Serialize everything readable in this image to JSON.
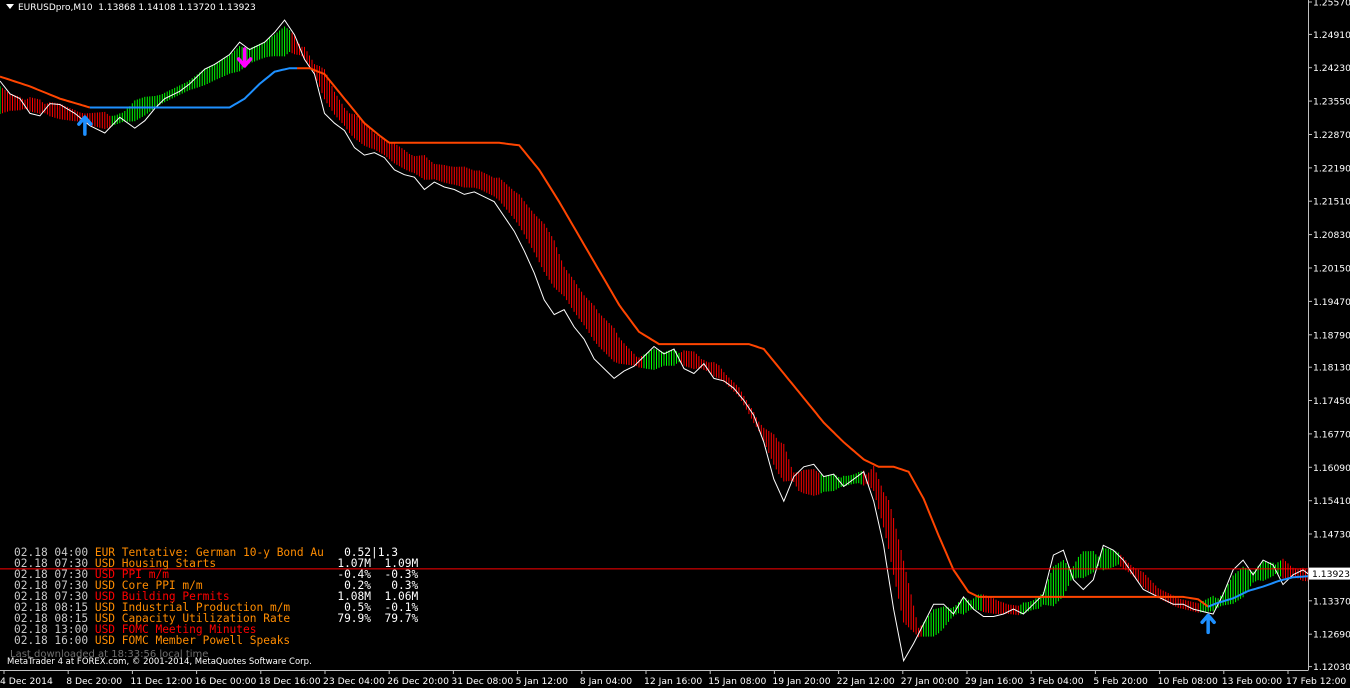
{
  "header": {
    "symbol": "EURUSDpro,M10",
    "ohlc": "1.13868 1.14108 1.13720 1.13923"
  },
  "chart_data": {
    "type": "line",
    "title": "EURUSDpro,M10",
    "x_tick_labels": [
      "4 Dec 2014",
      "8 Dec 20:00",
      "11 Dec 12:00",
      "16 Dec 00:00",
      "18 Dec 16:00",
      "23 Dec 04:00",
      "26 Dec 20:00",
      "31 Dec 08:00",
      "5 Jan 12:00",
      "8 Jan 04:00",
      "12 Jan 16:00",
      "15 Jan 08:00",
      "19 Jan 20:00",
      "22 Jan 12:00",
      "27 Jan 00:00",
      "29 Jan 16:00",
      "3 Feb 04:00",
      "5 Feb 20:00",
      "10 Feb 08:00",
      "13 Feb 00:00",
      "17 Feb 12:00"
    ],
    "y_tick_labels": [
      "1.25570",
      "1.24910",
      "1.24230",
      "1.23550",
      "1.22870",
      "1.22190",
      "1.21510",
      "1.20830",
      "1.20150",
      "1.19470",
      "1.18790",
      "1.18130",
      "1.17450",
      "1.16770",
      "1.16090",
      "1.15410",
      "1.14730",
      "1.13370",
      "1.12690",
      "1.12030"
    ],
    "ylim": [
      1.1196,
      1.2561
    ],
    "current_price": "1.13923",
    "current_price_value": 1.13923,
    "price_line_value": 1.1402,
    "colors": {
      "background": "#000000",
      "price": "#ffffff",
      "bull_histogram": "#00ff00",
      "bear_histogram": "#ff0000",
      "trail_line_down": "#ff4500",
      "trail_line_up": "#1e90ff",
      "buy_arrow": "#1e90ff",
      "sell_arrow": "#ff00ff",
      "price_line": "#ff0000"
    },
    "series": [
      {
        "role": "close",
        "points": [
          [
            0,
            1.2396
          ],
          [
            2,
            1.237
          ],
          [
            4,
            1.236
          ],
          [
            6,
            1.233
          ],
          [
            8,
            1.2325
          ],
          [
            10,
            1.235
          ],
          [
            12,
            1.2348
          ],
          [
            15,
            1.233
          ],
          [
            18,
            1.2305
          ],
          [
            21,
            1.229
          ],
          [
            24,
            1.2322
          ],
          [
            27,
            1.23
          ],
          [
            29,
            1.2315
          ],
          [
            31,
            1.234
          ],
          [
            33,
            1.236
          ],
          [
            36,
            1.2375
          ],
          [
            38,
            1.239
          ],
          [
            41,
            1.242
          ],
          [
            43,
            1.243
          ],
          [
            46,
            1.245
          ],
          [
            48,
            1.2475
          ],
          [
            50,
            1.246
          ],
          [
            53,
            1.2475
          ],
          [
            55,
            1.2495
          ],
          [
            57,
            1.252
          ],
          [
            59,
            1.249
          ],
          [
            61,
            1.244
          ],
          [
            63,
            1.241
          ],
          [
            65,
            1.233
          ],
          [
            67,
            1.231
          ],
          [
            69,
            1.2295
          ],
          [
            71,
            1.226
          ],
          [
            73,
            1.2245
          ],
          [
            75,
            1.225
          ],
          [
            77,
            1.224
          ],
          [
            79,
            1.2215
          ],
          [
            81,
            1.2205
          ],
          [
            83,
            1.22
          ],
          [
            85,
            1.2175
          ],
          [
            87,
            1.219
          ],
          [
            89,
            1.218
          ],
          [
            91,
            1.2175
          ],
          [
            93,
            1.2165
          ],
          [
            95,
            1.217
          ],
          [
            97,
            1.216
          ],
          [
            99,
            1.215
          ],
          [
            101,
            1.212
          ],
          [
            103,
            1.209
          ],
          [
            105,
            1.205
          ],
          [
            107,
            1.2005
          ],
          [
            109,
            1.195
          ],
          [
            111,
            1.192
          ],
          [
            113,
            1.193
          ],
          [
            115,
            1.1895
          ],
          [
            117,
            1.187
          ],
          [
            119,
            1.183
          ],
          [
            121,
            1.181
          ],
          [
            123,
            1.179
          ],
          [
            125,
            1.1805
          ],
          [
            127,
            1.1815
          ],
          [
            129,
            1.1835
          ],
          [
            131,
            1.1855
          ],
          [
            133,
            1.184
          ],
          [
            135,
            1.185
          ],
          [
            137,
            1.181
          ],
          [
            139,
            1.18
          ],
          [
            141,
            1.182
          ],
          [
            143,
            1.179
          ],
          [
            145,
            1.1785
          ],
          [
            147,
            1.177
          ],
          [
            149,
            1.1745
          ],
          [
            151,
            1.1715
          ],
          [
            153,
            1.166
          ],
          [
            155,
            1.1585
          ],
          [
            157,
            1.154
          ],
          [
            159,
            1.159
          ],
          [
            161,
            1.161
          ],
          [
            163,
            1.1615
          ],
          [
            165,
            1.159
          ],
          [
            167,
            1.1595
          ],
          [
            169,
            1.157
          ],
          [
            171,
            1.1585
          ],
          [
            173,
            1.16
          ],
          [
            175,
            1.154
          ],
          [
            177,
            1.145
          ],
          [
            179,
            1.132
          ],
          [
            181,
            1.1215
          ],
          [
            183,
            1.125
          ],
          [
            185,
            1.129
          ],
          [
            187,
            1.133
          ],
          [
            189,
            1.133
          ],
          [
            191,
            1.131
          ],
          [
            193,
            1.1345
          ],
          [
            195,
            1.132
          ],
          [
            197,
            1.1305
          ],
          [
            199,
            1.1305
          ],
          [
            201,
            1.131
          ],
          [
            203,
            1.132
          ],
          [
            205,
            1.131
          ],
          [
            207,
            1.133
          ],
          [
            209,
            1.135
          ],
          [
            211,
            1.143
          ],
          [
            213,
            1.144
          ],
          [
            215,
            1.138
          ],
          [
            217,
            1.136
          ],
          [
            219,
            1.138
          ],
          [
            221,
            1.145
          ],
          [
            223,
            1.144
          ],
          [
            225,
            1.142
          ],
          [
            227,
            1.139
          ],
          [
            229,
            1.136
          ],
          [
            231,
            1.135
          ],
          [
            233,
            1.134
          ],
          [
            235,
            1.133
          ],
          [
            237,
            1.133
          ],
          [
            239,
            1.132
          ],
          [
            241,
            1.1315
          ],
          [
            243,
            1.131
          ],
          [
            245,
            1.135
          ],
          [
            247,
            1.14
          ],
          [
            249,
            1.142
          ],
          [
            251,
            1.139
          ],
          [
            253,
            1.142
          ],
          [
            255,
            1.141
          ],
          [
            257,
            1.137
          ],
          [
            259,
            1.139
          ],
          [
            261,
            1.14
          ],
          [
            262,
            1.1392
          ]
        ]
      },
      {
        "role": "trail",
        "points": [
          [
            0,
            1.2405
          ],
          [
            6,
            1.2385
          ],
          [
            12,
            1.236
          ],
          [
            18,
            1.2342
          ],
          [
            23,
            1.2342
          ],
          [
            24,
            1.2342
          ],
          [
            30,
            1.2342
          ],
          [
            36,
            1.2342
          ],
          [
            42,
            1.2342
          ],
          [
            46,
            1.2342
          ],
          [
            49,
            1.236
          ],
          [
            52,
            1.239
          ],
          [
            55,
            1.2415
          ],
          [
            58,
            1.2422
          ],
          [
            62,
            1.2422
          ],
          [
            65,
            1.241
          ],
          [
            69,
            1.236
          ],
          [
            73,
            1.231
          ],
          [
            76,
            1.2285
          ],
          [
            78,
            1.227
          ],
          [
            80,
            1.227
          ],
          [
            100,
            1.227
          ],
          [
            104,
            1.2265
          ],
          [
            108,
            1.2215
          ],
          [
            112,
            1.215
          ],
          [
            116,
            1.208
          ],
          [
            120,
            1.201
          ],
          [
            124,
            1.194
          ],
          [
            128,
            1.1885
          ],
          [
            132,
            1.186
          ],
          [
            136,
            1.186
          ],
          [
            150,
            1.186
          ],
          [
            153,
            1.185
          ],
          [
            157,
            1.18
          ],
          [
            161,
            1.175
          ],
          [
            165,
            1.17
          ],
          [
            169,
            1.166
          ],
          [
            173,
            1.1625
          ],
          [
            176,
            1.161
          ],
          [
            179,
            1.161
          ],
          [
            182,
            1.16
          ],
          [
            185,
            1.1545
          ],
          [
            188,
            1.147
          ],
          [
            191,
            1.14
          ],
          [
            194,
            1.1355
          ],
          [
            196,
            1.1345
          ],
          [
            200,
            1.1345
          ],
          [
            230,
            1.1345
          ],
          [
            237,
            1.1345
          ],
          [
            240,
            1.134
          ],
          [
            242,
            1.1325
          ],
          [
            244,
            1.1333
          ],
          [
            247,
            1.1342
          ],
          [
            250,
            1.1357
          ],
          [
            253,
            1.1366
          ],
          [
            256,
            1.1377
          ],
          [
            259,
            1.1385
          ],
          [
            262,
            1.1387
          ]
        ]
      },
      {
        "role": "smooth",
        "points": [
          [
            0,
            1.235
          ],
          [
            6,
            1.2345
          ],
          [
            12,
            1.233
          ],
          [
            18,
            1.2315
          ],
          [
            22,
            1.231
          ],
          [
            26,
            1.2325
          ],
          [
            30,
            1.2345
          ],
          [
            36,
            1.2375
          ],
          [
            42,
            1.2405
          ],
          [
            48,
            1.2435
          ],
          [
            54,
            1.246
          ],
          [
            58,
            1.2472
          ],
          [
            61,
            1.245
          ],
          [
            64,
            1.24
          ],
          [
            67,
            1.2345
          ],
          [
            70,
            1.2305
          ],
          [
            74,
            1.2275
          ],
          [
            78,
            1.225
          ],
          [
            82,
            1.2225
          ],
          [
            86,
            1.221
          ],
          [
            90,
            1.22
          ],
          [
            96,
            1.219
          ],
          [
            100,
            1.217
          ],
          [
            104,
            1.2125
          ],
          [
            108,
            1.206
          ],
          [
            112,
            1.1995
          ],
          [
            116,
            1.1935
          ],
          [
            120,
            1.188
          ],
          [
            124,
            1.184
          ],
          [
            128,
            1.182
          ],
          [
            132,
            1.1825
          ],
          [
            136,
            1.183
          ],
          [
            140,
            1.182
          ],
          [
            144,
            1.18
          ],
          [
            148,
            1.176
          ],
          [
            152,
            1.169
          ],
          [
            156,
            1.162
          ],
          [
            160,
            1.1575
          ],
          [
            164,
            1.157
          ],
          [
            168,
            1.1575
          ],
          [
            172,
            1.1585
          ],
          [
            175,
            1.158
          ],
          [
            178,
            1.148
          ],
          [
            181,
            1.134
          ],
          [
            184,
            1.127
          ],
          [
            188,
            1.129
          ],
          [
            192,
            1.132
          ],
          [
            196,
            1.133
          ],
          [
            200,
            1.132
          ],
          [
            204,
            1.1315
          ],
          [
            208,
            1.133
          ],
          [
            212,
            1.1365
          ],
          [
            216,
            1.14
          ],
          [
            220,
            1.1415
          ],
          [
            224,
            1.142
          ],
          [
            228,
            1.1385
          ],
          [
            232,
            1.135
          ],
          [
            236,
            1.133
          ],
          [
            240,
            1.132
          ],
          [
            244,
            1.133
          ],
          [
            248,
            1.136
          ],
          [
            252,
            1.139
          ],
          [
            256,
            1.14
          ],
          [
            260,
            1.139
          ],
          [
            262,
            1.1385
          ]
        ]
      }
    ],
    "arrows": [
      {
        "kind": "buy",
        "x": 17,
        "y": 1.23
      },
      {
        "kind": "sell",
        "x": 49,
        "y": 1.2445
      },
      {
        "kind": "buy",
        "x": 242,
        "y": 1.1285
      }
    ]
  },
  "news": [
    {
      "time": "02.18 04:00",
      "cur": "EUR",
      "event": "Tentative: German 10-y Bond Au",
      "actual": "0.52",
      "forecast": "1.3",
      "sep": "|",
      "color": "orange"
    },
    {
      "time": "02.18 07:30",
      "cur": "USD",
      "event": "Housing Starts",
      "actual": "1.07M",
      "forecast": "1.09M",
      "sep": "",
      "color": "orange"
    },
    {
      "time": "02.18 07:30",
      "cur": "USD",
      "event": "PPI m/m",
      "actual": "-0.4%",
      "forecast": "-0.3%",
      "sep": "",
      "color": "red"
    },
    {
      "time": "02.18 07:30",
      "cur": "USD",
      "event": "Core PPI m/m",
      "actual": "0.2%",
      "forecast": "0.3%",
      "sep": "",
      "color": "orange"
    },
    {
      "time": "02.18 07:30",
      "cur": "USD",
      "event": "Building Permits",
      "actual": "1.08M",
      "forecast": "1.06M",
      "sep": "",
      "color": "red"
    },
    {
      "time": "02.18 08:15",
      "cur": "USD",
      "event": "Industrial Production m/m",
      "actual": "0.5%",
      "forecast": "-0.1%",
      "sep": "",
      "color": "orange"
    },
    {
      "time": "02.18 08:15",
      "cur": "USD",
      "event": "Capacity Utilization Rate",
      "actual": "79.9%",
      "forecast": "79.7%",
      "sep": "",
      "color": "orange"
    },
    {
      "time": "02.18 13:00",
      "cur": "USD",
      "event": "FOMC Meeting Minutes",
      "actual": "",
      "forecast": "",
      "sep": "",
      "color": "red"
    },
    {
      "time": "02.18 16:00",
      "cur": "USD",
      "event": "FOMC Member Powell Speaks",
      "actual": "",
      "forecast": "",
      "sep": "",
      "color": "orange"
    }
  ],
  "footer": {
    "downloaded": "Last downloaded at 18:33:56 local time",
    "credit": "MetaTrader 4 at FOREX.com, © 2001-2014, MetaQuotes Software Corp."
  }
}
